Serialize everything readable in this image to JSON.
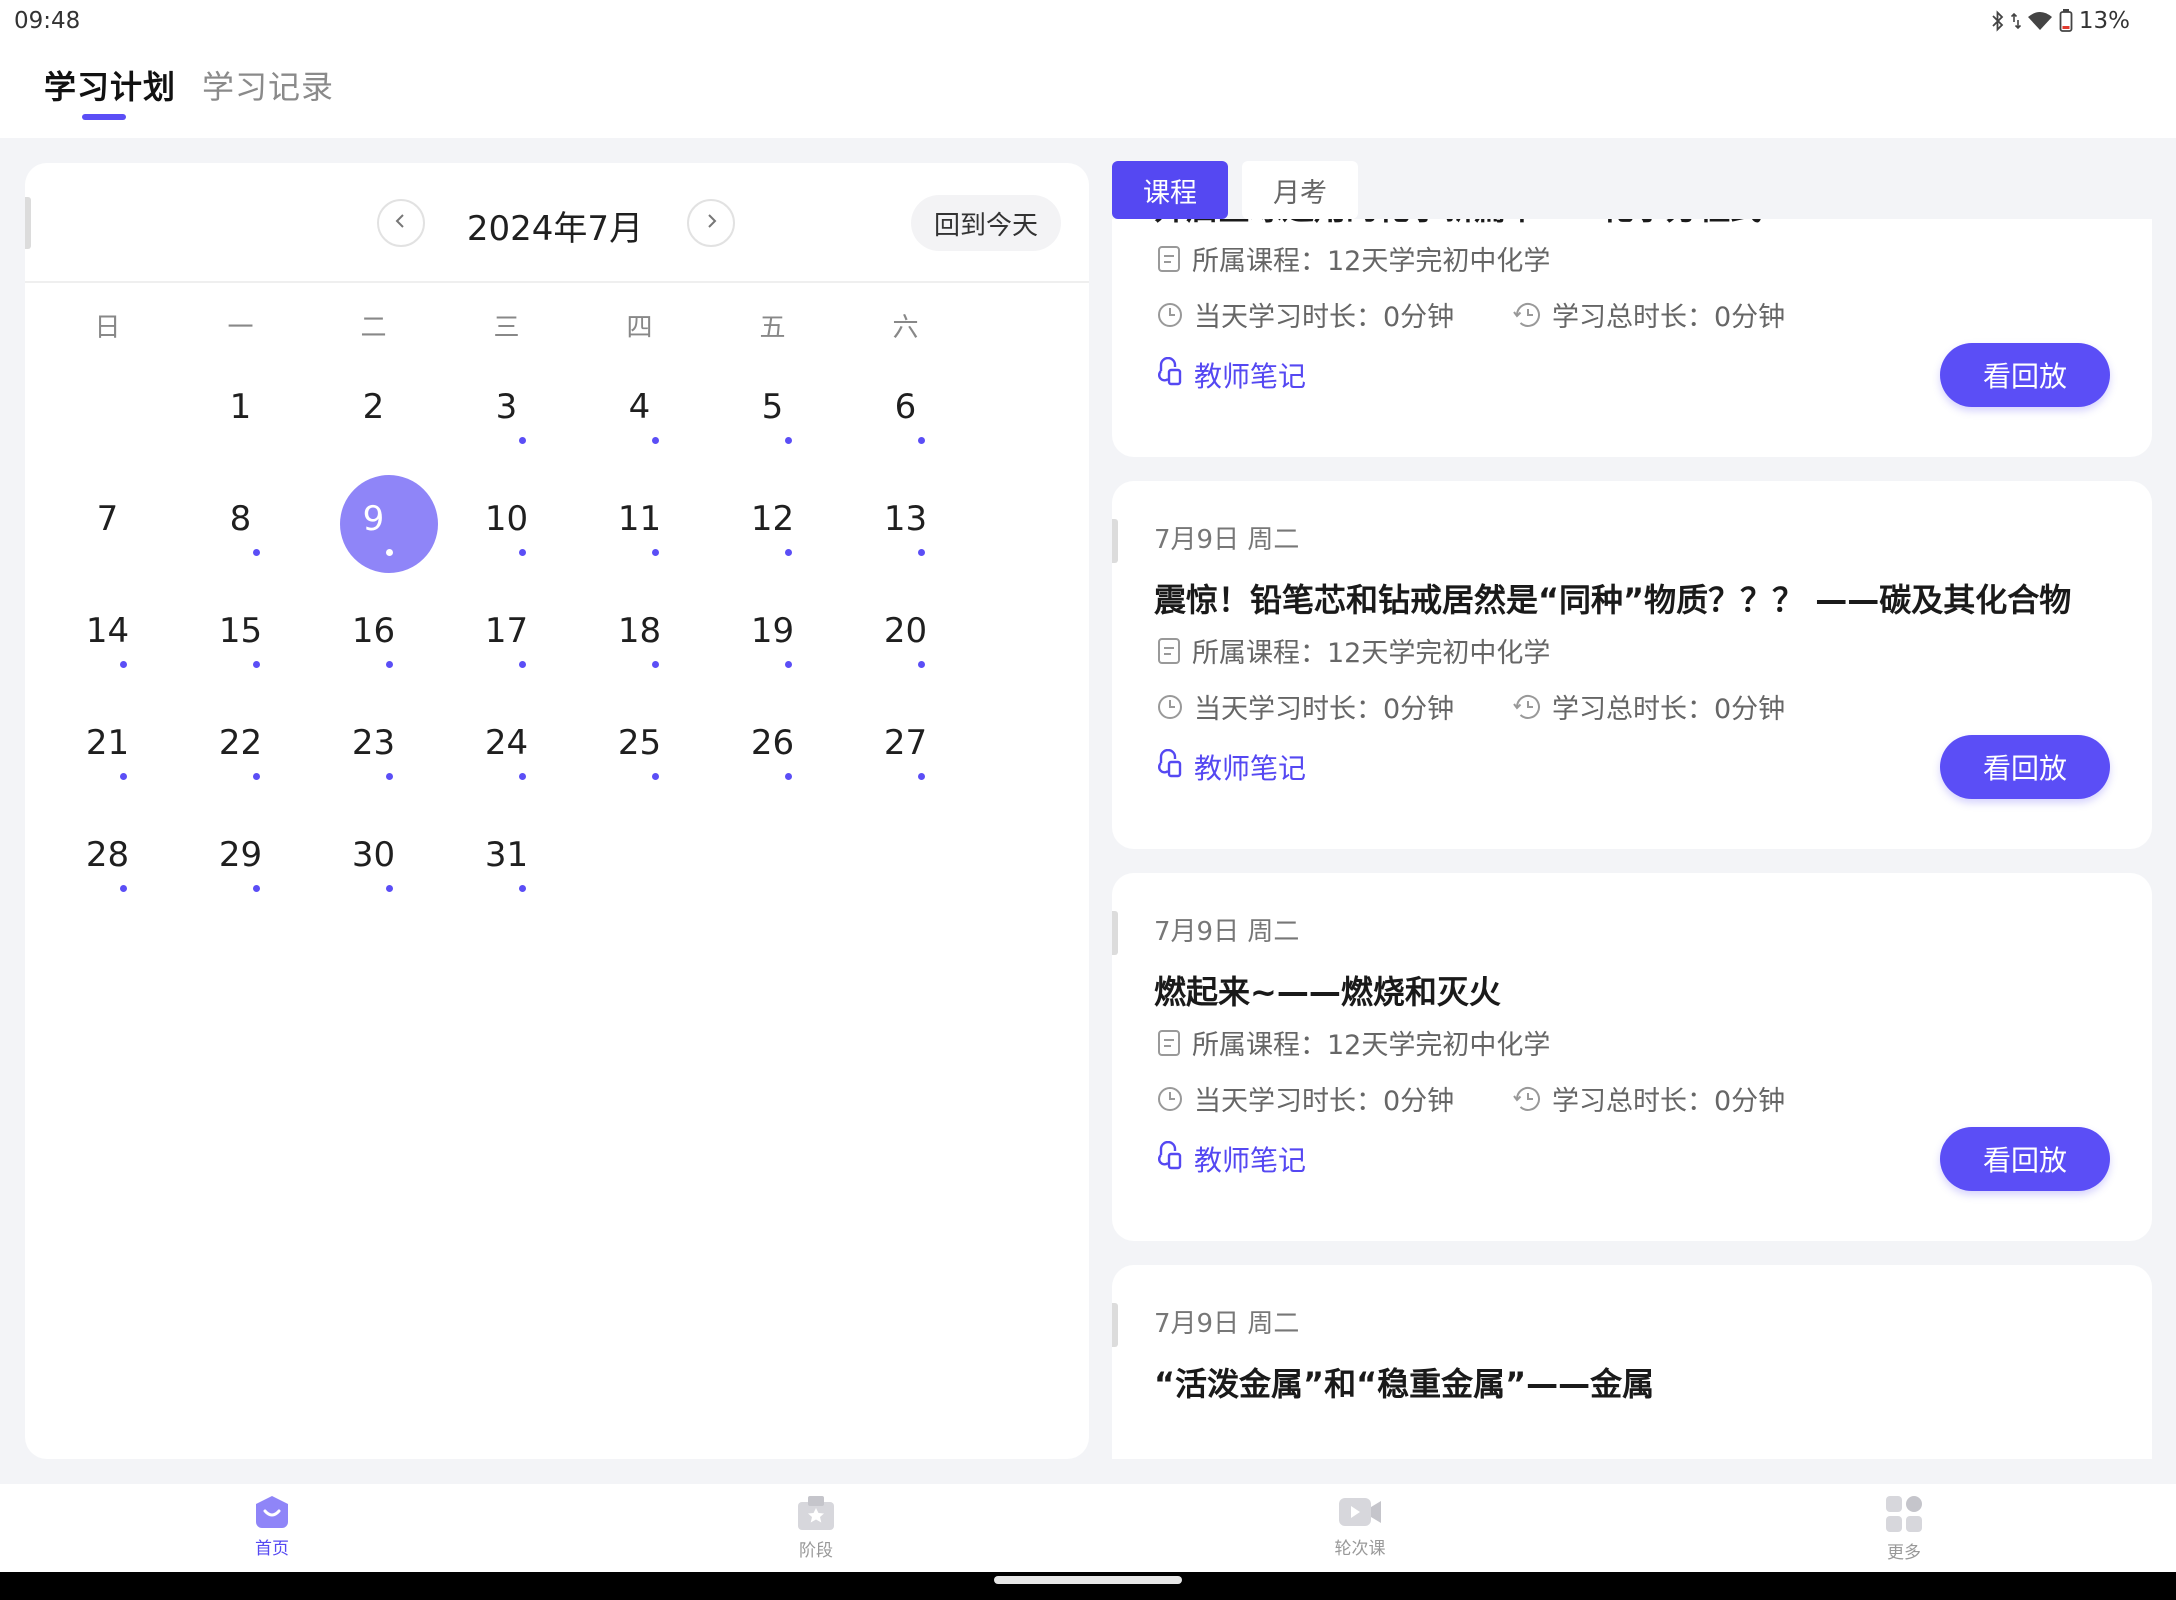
{
  "status_bar": {
    "time": "09:48",
    "battery": "13%"
  },
  "top_tabs": [
    {
      "label": "学习计划",
      "active": true
    },
    {
      "label": "学习记录",
      "active": false
    }
  ],
  "calendar": {
    "title": "2024年7月",
    "today_button": "回到今天",
    "weekdays": [
      "日",
      "一",
      "二",
      "三",
      "四",
      "五",
      "六"
    ],
    "first_weekday_index": 1,
    "selected_day": 9,
    "days": [
      {
        "d": "1",
        "dot": false
      },
      {
        "d": "2",
        "dot": false
      },
      {
        "d": "3",
        "dot": true
      },
      {
        "d": "4",
        "dot": true
      },
      {
        "d": "5",
        "dot": true
      },
      {
        "d": "6",
        "dot": true
      },
      {
        "d": "7",
        "dot": false
      },
      {
        "d": "8",
        "dot": true
      },
      {
        "d": "9",
        "dot": true
      },
      {
        "d": "10",
        "dot": true
      },
      {
        "d": "11",
        "dot": true
      },
      {
        "d": "12",
        "dot": true
      },
      {
        "d": "13",
        "dot": true
      },
      {
        "d": "14",
        "dot": true
      },
      {
        "d": "15",
        "dot": true
      },
      {
        "d": "16",
        "dot": true
      },
      {
        "d": "17",
        "dot": true
      },
      {
        "d": "18",
        "dot": true
      },
      {
        "d": "19",
        "dot": true
      },
      {
        "d": "20",
        "dot": true
      },
      {
        "d": "21",
        "dot": true
      },
      {
        "d": "22",
        "dot": true
      },
      {
        "d": "23",
        "dot": true
      },
      {
        "d": "24",
        "dot": true
      },
      {
        "d": "25",
        "dot": true
      },
      {
        "d": "26",
        "dot": true
      },
      {
        "d": "27",
        "dot": true
      },
      {
        "d": "28",
        "dot": true
      },
      {
        "d": "29",
        "dot": true
      },
      {
        "d": "30",
        "dot": true
      },
      {
        "d": "31",
        "dot": true
      }
    ]
  },
  "content_tabs": [
    {
      "label": "课程",
      "active": true
    },
    {
      "label": "月考",
      "active": false
    }
  ],
  "colors": {
    "accent": "#5b4ef6",
    "selected_day": "#8f85f8",
    "page_bg": "#f3f4f7"
  },
  "cards": [
    {
      "date": "",
      "title": "开启全球通用的化学新篇章——化学方程式",
      "course": "所属课程：12天学完初中化学",
      "day_time": "当天学习时长：0分钟",
      "total_time": "学习总时长：0分钟",
      "notes": "教师笔记",
      "replay": "看回放"
    },
    {
      "date": "7月9日 周二",
      "title": "震惊！铅笔芯和钻戒居然是“同种”物质？？？ ——碳及其化合物",
      "course": "所属课程：12天学完初中化学",
      "day_time": "当天学习时长：0分钟",
      "total_time": "学习总时长：0分钟",
      "notes": "教师笔记",
      "replay": "看回放"
    },
    {
      "date": "7月9日 周二",
      "title": "燃起来~——燃烧和灭火",
      "course": "所属课程：12天学完初中化学",
      "day_time": "当天学习时长：0分钟",
      "total_time": "学习总时长：0分钟",
      "notes": "教师笔记",
      "replay": "看回放"
    },
    {
      "date": "7月9日 周二",
      "title": "“活泼金属”和“稳重金属”——金属"
    }
  ],
  "bottom_nav": [
    {
      "label": "首页",
      "icon": "home-icon",
      "active": true
    },
    {
      "label": "阶段",
      "icon": "stage-icon",
      "active": false
    },
    {
      "label": "轮次课",
      "icon": "video-icon",
      "active": false
    },
    {
      "label": "更多",
      "icon": "more-grid-icon",
      "active": false
    }
  ]
}
